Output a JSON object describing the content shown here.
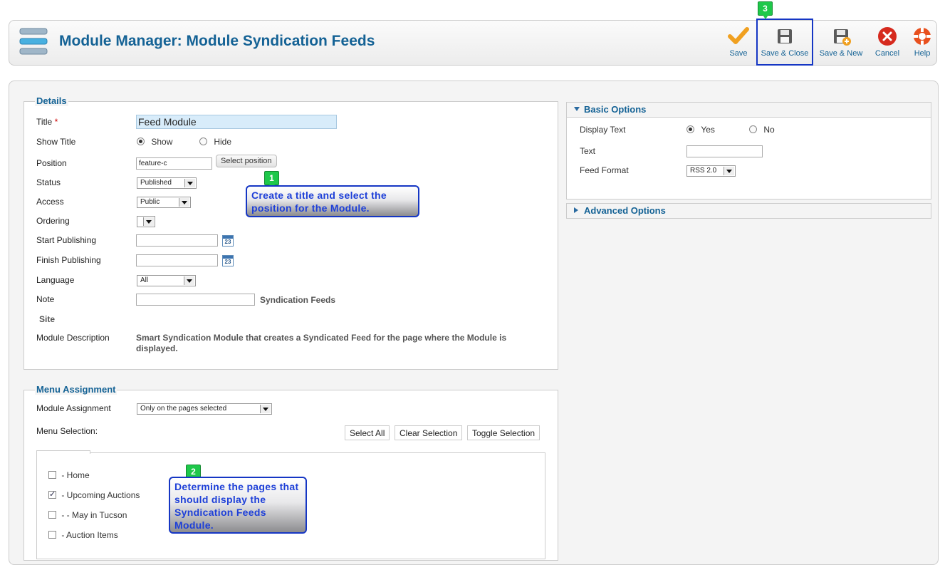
{
  "header": {
    "title": "Module Manager: Module Syndication Feeds"
  },
  "toolbar": {
    "buttons": [
      {
        "label": "Save",
        "icon": "check-icon"
      },
      {
        "label": "Save & Close",
        "icon": "floppy-disk-icon"
      },
      {
        "label": "Save & New",
        "icon": "floppy-disk-plus-icon"
      },
      {
        "label": "Cancel",
        "icon": "cancel-icon"
      },
      {
        "label": "Help",
        "icon": "help-lifebuoy-icon"
      }
    ]
  },
  "details": {
    "legend": "Details",
    "title_label": "Title",
    "required_mark": "*",
    "title_value": "Feed Module",
    "show_title_label": "Show Title",
    "show_option": "Show",
    "hide_option": "Hide",
    "position_label": "Position",
    "position_value": "feature-c",
    "select_position_button": "Select position",
    "status_label": "Status",
    "status_value": "Published",
    "access_label": "Access",
    "access_value": "Public",
    "ordering_label": "Ordering",
    "ordering_value": "",
    "start_publishing_label": "Start Publishing",
    "finish_publishing_label": "Finish Publishing",
    "calendar_day": "23",
    "language_label": "Language",
    "language_value": "All",
    "note_label": "Note",
    "note_value": "",
    "note_suffix": "Syndication Feeds",
    "site_label": "Site",
    "module_description_label": "Module Description",
    "module_description": "Smart Syndication Module that creates a Syndicated Feed for the page where the Module is displayed."
  },
  "menu_assignment": {
    "legend": "Menu Assignment",
    "module_assignment_label": "Module Assignment",
    "module_assignment_value": "Only on the pages selected",
    "menu_selection_label": "Menu Selection:",
    "select_all": "Select All",
    "clear_selection": "Clear Selection",
    "toggle_selection": "Toggle Selection",
    "items": [
      {
        "label": "- Home",
        "checked": false
      },
      {
        "label": "- Upcoming Auctions",
        "checked": true
      },
      {
        "label": "- - May in Tucson",
        "checked": false
      },
      {
        "label": "- Auction Items",
        "checked": false
      }
    ]
  },
  "basic_options": {
    "heading": "Basic Options",
    "display_text_label": "Display Text",
    "yes_option": "Yes",
    "no_option": "No",
    "text_label": "Text",
    "text_value": "",
    "feed_format_label": "Feed Format",
    "feed_format_value": "RSS 2.0"
  },
  "advanced_options": {
    "heading": "Advanced Options"
  },
  "callouts": {
    "c1": {
      "badge": "1",
      "text": "Create a title and select the position for the Module."
    },
    "c2": {
      "badge": "2",
      "text": "Determine the pages that should display the Syndication Feeds Module."
    },
    "c3": {
      "badge": "3"
    }
  },
  "colors": {
    "accent": "#146295",
    "callout_border": "#1536c4",
    "badge_green": "#1ec84a"
  }
}
